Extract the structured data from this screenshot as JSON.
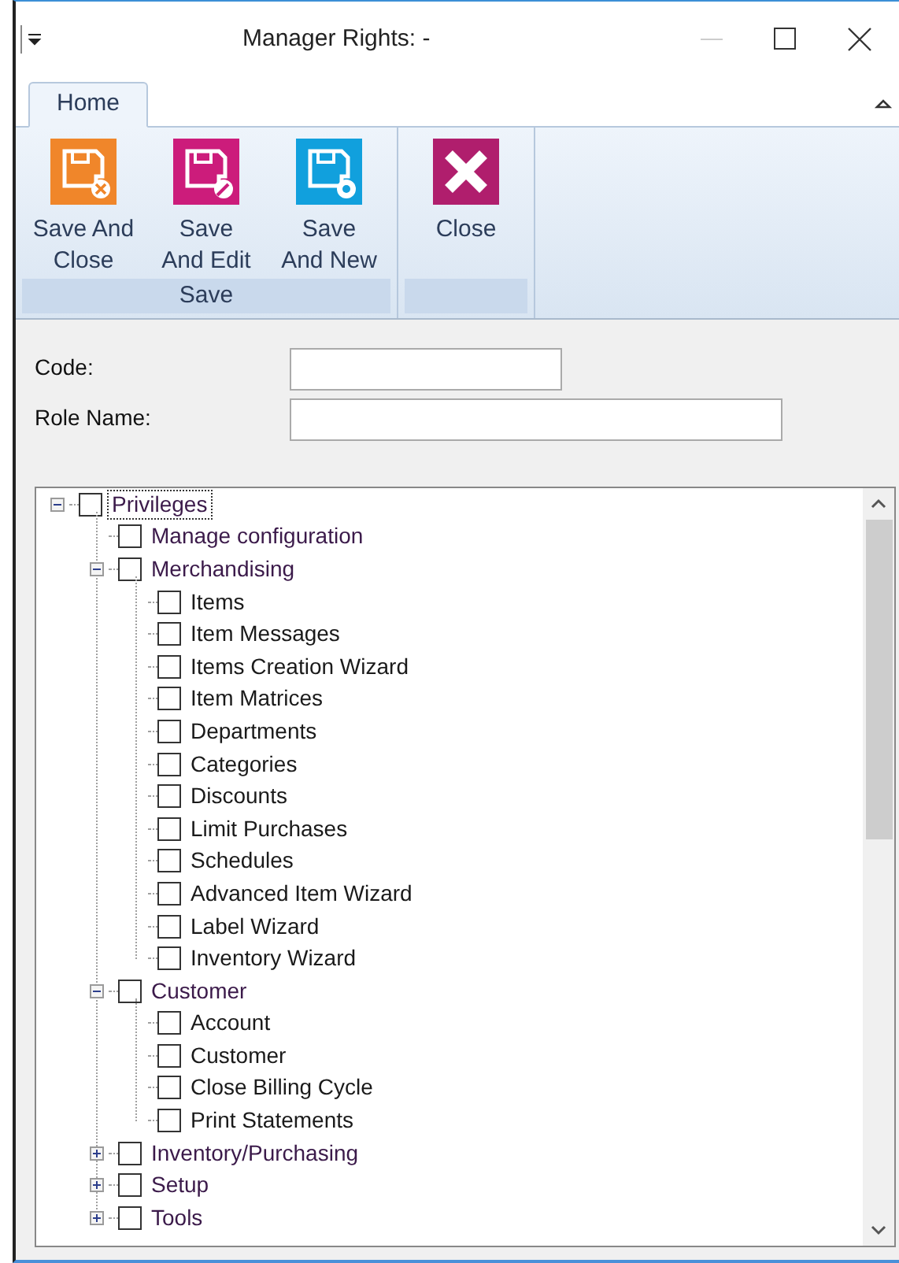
{
  "window": {
    "title": "Manager Rights: -"
  },
  "tabs": [
    {
      "label": "Home",
      "selected": true
    }
  ],
  "ribbon_groups": [
    {
      "label": "Save",
      "buttons": [
        {
          "label": "Save And Close",
          "kind": "save-close"
        },
        {
          "label": "Save And Edit",
          "kind": "save-edit"
        },
        {
          "label": "Save And New",
          "kind": "save-new"
        }
      ]
    },
    {
      "buttons": [
        {
          "label": "Close",
          "kind": "close"
        }
      ]
    }
  ],
  "form": {
    "code_label": "Code:",
    "role_name_label": "Role Name:"
  },
  "tree": [
    {
      "label": "Privileges",
      "checked": false,
      "expanded": true,
      "focused": true,
      "children": [
        {
          "label": "Manage configuration",
          "checked": false,
          "focused": false
        },
        {
          "label": "Merchandising",
          "checked": false,
          "focused": false,
          "expanded": true,
          "children": [
            {
              "label": "Items",
              "checked": false,
              "focused": false
            },
            {
              "label": "Item Messages",
              "checked": false,
              "focused": false
            },
            {
              "label": "Items Creation Wizard",
              "checked": false,
              "focused": false
            },
            {
              "label": "Item Matrices",
              "checked": false,
              "focused": false
            },
            {
              "label": "Departments",
              "checked": false,
              "focused": false
            },
            {
              "label": "Categories",
              "checked": false,
              "focused": false
            },
            {
              "label": "Discounts",
              "checked": false,
              "focused": false
            },
            {
              "label": "Limit Purchases",
              "checked": false,
              "focused": false
            },
            {
              "label": "Schedules",
              "checked": false,
              "focused": false
            },
            {
              "label": "Advanced Item Wizard",
              "checked": false,
              "focused": false
            },
            {
              "label": "Label Wizard",
              "checked": false,
              "focused": false
            },
            {
              "label": "Inventory Wizard",
              "checked": false,
              "focused": false
            }
          ]
        },
        {
          "label": "Customer",
          "checked": false,
          "focused": false,
          "expanded": true,
          "children": [
            {
              "label": "Account",
              "checked": false,
              "focused": false
            },
            {
              "label": "Customer",
              "checked": false,
              "focused": false
            },
            {
              "label": "Close Billing Cycle",
              "checked": false,
              "focused": false
            },
            {
              "label": "Print Statements",
              "checked": false,
              "focused": false
            }
          ]
        },
        {
          "label": "Inventory/Purchasing",
          "checked": false,
          "focused": false,
          "expanded": false
        },
        {
          "label": "Setup",
          "checked": false,
          "focused": false,
          "expanded": false
        },
        {
          "label": "Tools",
          "checked": false,
          "focused": false,
          "expanded": false
        }
      ]
    }
  ]
}
